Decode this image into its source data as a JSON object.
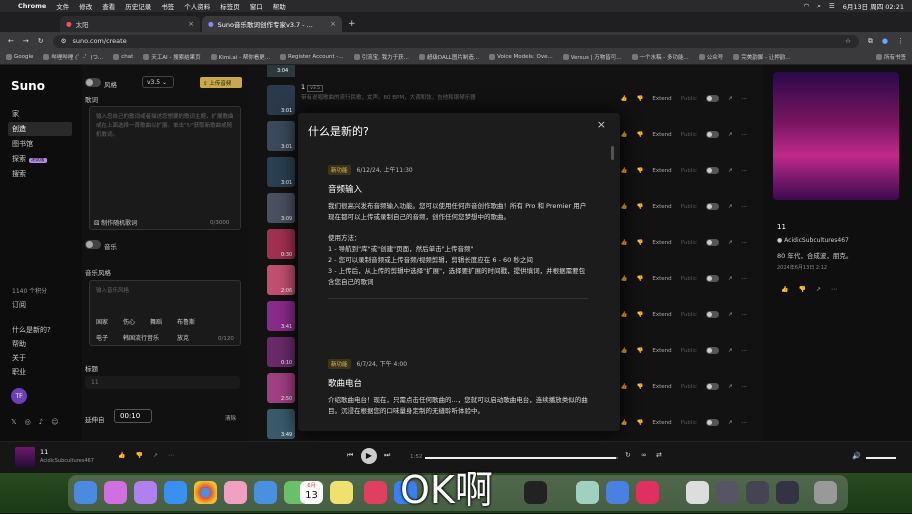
{
  "menubar": {
    "app": "Chrome",
    "items": [
      "文件",
      "修改",
      "查看",
      "历史记录",
      "书签",
      "个人资料",
      "标签页",
      "窗口",
      "帮助"
    ],
    "datetime": "6月13日 周四 02:21"
  },
  "tabs": [
    {
      "title": "太阳"
    },
    {
      "title": "Suno音乐歌词创作专家v3.7 - ..."
    }
  ],
  "address": {
    "url": "suno.com/create"
  },
  "bookmarks": [
    "Google",
    "哔哩哔哩 (゜-゜)つ...",
    "chat",
    "天工AI - 搜索结果页",
    "Kimi.ai - 帮你看更...",
    "Register Account -...",
    "引流宝, 我力于获...",
    "超级DALL图片制造...",
    "Voice Models: Ove...",
    "Versus | 万物皆可...",
    "一个水稿 - 多功能...",
    "公众号",
    "完美韵脚 - 让押韵..."
  ],
  "bookmarks_all": "所有书签",
  "sidebar": {
    "logo": "Suno",
    "items": [
      "家",
      "创造",
      "图书馆",
      "探索",
      "搜索"
    ],
    "explore_badge": "测试版",
    "credits": "1140 个积分",
    "subscribe": "订阅",
    "links": [
      "什么是新的?",
      "帮助",
      "关于",
      "职业"
    ],
    "avatar": "TF"
  },
  "form": {
    "instrumental": "风格",
    "version": "v3.5",
    "upload": "上传音频",
    "lyrics_label": "歌词",
    "lyrics_placeholder": "输入您自己的歌词或者描述您想要的歌词主题，扩展歌曲或在上面选择一首歌曲以扩展。单击\"↻\"获取新歌曲或随机歌词。",
    "random_lyrics": "制作随机歌词",
    "lyrics_count": "0/3000",
    "music_toggle": "音乐",
    "style_label": "音乐风格",
    "style_placeholder": "输入音乐风格",
    "styles": [
      "国家",
      "伤心",
      "舞蹈",
      "布鲁斯",
      "电子",
      "韩国流行音乐",
      "放克"
    ],
    "style_count": "0/120",
    "title_label": "标题",
    "title_value": "11",
    "extend_label": "延伸自",
    "extend_time": "00:10",
    "clear": "清除"
  },
  "songlist": {
    "first_title": "1",
    "first_tag": "v3.5",
    "first_desc": "带有说唱歌曲的流行民歌，女声。80 BPM，大调和弦，吉他和钢琴乐器",
    "time_top": "3:04",
    "times": [
      "3:01",
      "3:01",
      "3:01",
      "3:09",
      "0:30",
      "2:06",
      "3:41",
      "0:10",
      "2:50",
      "3:49"
    ],
    "extend": "Extend",
    "public": "Public"
  },
  "modal": {
    "title": "什么是新的?",
    "close": "×",
    "entries": [
      {
        "tag": "新功能",
        "date": "6/12/24, 上午11:30",
        "title": "音频输入",
        "body": "我们很高兴发布音频输入功能。您可以使用任何声音创作歌曲！所有 Pro 和 Premier 用户现在都可以上传或录制自己的音频，创作任何您梦想中的歌曲。",
        "howto_title": "使用方法：",
        "steps": [
          "1 - 导航到\"库\"或\"创建\"页面，然后单击\"上传音频\"",
          "2 - 您可以录制音频或上传音频/视频剪辑，剪辑长度应在 6 - 60 秒之间",
          "3 - 上传后，从上传的剪辑中选择\"扩展\"，选择要扩展的时间戳，提供填词，并根据需要包含您自己的歌词"
        ]
      },
      {
        "tag": "新功能",
        "date": "6/7/24, 下午 4:00",
        "title": "歌曲电台",
        "body": "介绍歌曲电台！现在，只需点击任何歌曲的...，您就可以启动歌曲电台，连续播放类似的曲目。沉浸在根据您的口味量身定制的无缝聆听体验中。"
      }
    ]
  },
  "rightpanel": {
    "title": "11",
    "artist": "AcidicSubcultures467",
    "desc": "80 年代，合成波，朋克。",
    "date": "2024年6月13日 2:12"
  },
  "player": {
    "title": "11",
    "artist": "AcidicSubcultures467",
    "elapsed": "1:52",
    "progress": 0.99
  },
  "subtitle": "OK啊",
  "dock_calendar": {
    "month": "6月",
    "day": "13"
  },
  "colors": {
    "accent_tag": "#e0c060",
    "upload_btn": "#c9a94a"
  }
}
